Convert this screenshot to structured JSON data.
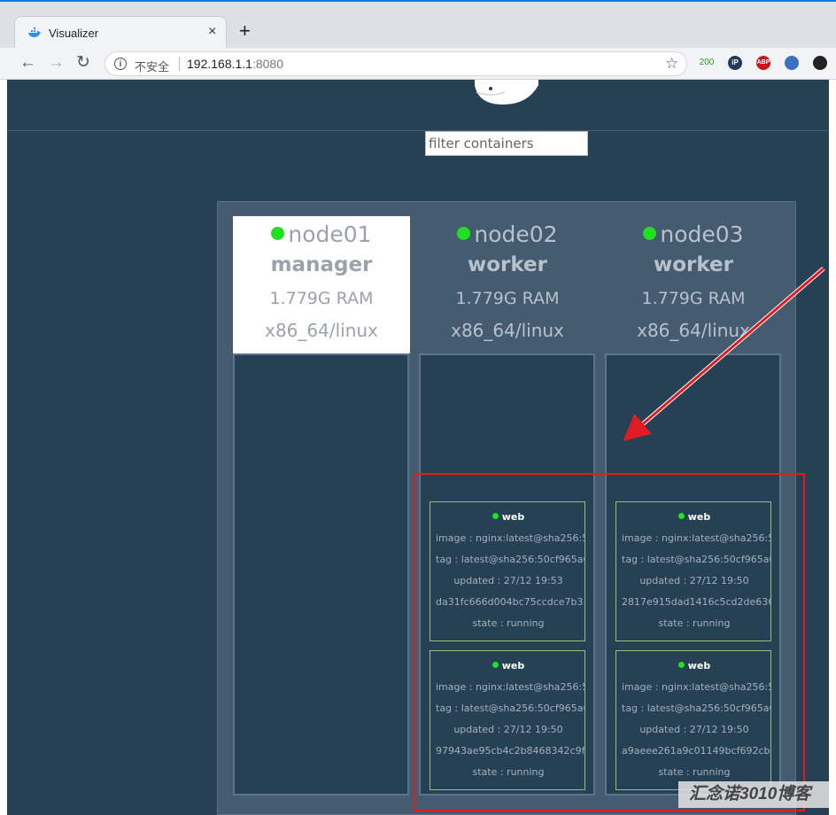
{
  "browser": {
    "tab_title": "Visualizer",
    "tab_close": "×",
    "new_tab": "+",
    "security_label": "不安全",
    "url_host": "192.168.1.1",
    "url_port": ":8080",
    "ext_badge_count": "200",
    "ext_abp": "ABP",
    "ext_ip": "iP"
  },
  "filter": {
    "placeholder": "filter containers"
  },
  "nodes": [
    {
      "name": "node01",
      "role": "manager",
      "ram": "1.779G RAM",
      "arch": "x86_64/linux",
      "containers": []
    },
    {
      "name": "node02",
      "role": "worker",
      "ram": "1.779G RAM",
      "arch": "x86_64/linux",
      "containers": [
        {
          "name": "web",
          "image": "image : nginx:latest@sha256:5",
          "tag": "tag : latest@sha256:50cf965a6",
          "updated": "updated : 27/12 19:53",
          "id": "da31fc666d004bc75ccdce7b3",
          "state": "state : running"
        },
        {
          "name": "web",
          "image": "image : nginx:latest@sha256:5",
          "tag": "tag : latest@sha256:50cf965a6",
          "updated": "updated : 27/12 19:50",
          "id": "97943ae95cb4c2b8468342c9f",
          "state": "state : running"
        }
      ]
    },
    {
      "name": "node03",
      "role": "worker",
      "ram": "1.779G RAM",
      "arch": "x86_64/linux",
      "containers": [
        {
          "name": "web",
          "image": "image : nginx:latest@sha256:5",
          "tag": "tag : latest@sha256:50cf965a6",
          "updated": "updated : 27/12 19:50",
          "id": "2817e915dad1416c5cd2de636",
          "state": "state : running"
        },
        {
          "name": "web",
          "image": "image : nginx:latest@sha256:5",
          "tag": "tag : latest@sha256:50cf965a6",
          "updated": "updated : 27/12 19:50",
          "id": "a9aeee261a9c01149bcf692cb",
          "state": "state : running"
        }
      ]
    }
  ],
  "watermark": "汇念诺3010博客",
  "colors": {
    "accent_green": "#20e020",
    "app_bg": "#264154",
    "annotation_red": "#e01b22"
  }
}
